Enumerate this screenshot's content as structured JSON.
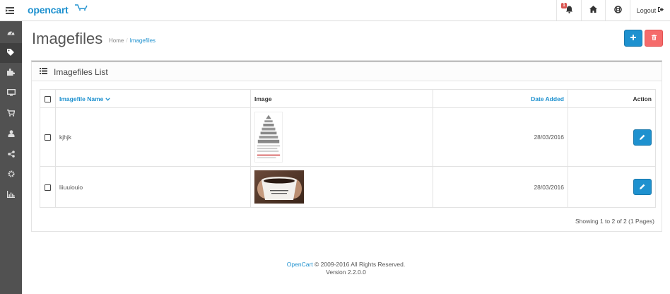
{
  "header": {
    "logo_text": "opencart",
    "notification_count": "1",
    "logout_label": "Logout"
  },
  "sidebar": {
    "items": [
      {
        "icon": "dashboard-icon"
      },
      {
        "icon": "tags-icon",
        "active": true
      },
      {
        "icon": "puzzle-icon"
      },
      {
        "icon": "desktop-icon"
      },
      {
        "icon": "shopping-cart-icon"
      },
      {
        "icon": "user-icon"
      },
      {
        "icon": "share-icon"
      },
      {
        "icon": "cog-icon"
      },
      {
        "icon": "bar-chart-icon"
      }
    ]
  },
  "page": {
    "title": "Imagefiles",
    "breadcrumb": [
      "Home",
      "Imagefiles"
    ],
    "add_button_icon": "plus-icon",
    "delete_button_icon": "trash-icon"
  },
  "panel": {
    "title": "Imagefiles List",
    "columns": {
      "name": "Imagefile Name",
      "image": "Image",
      "date_added": "Date Added",
      "action": "Action"
    },
    "rows": [
      {
        "name": "kjhjk",
        "image": "pyramid-diagram-thumbnail",
        "date_added": "28/03/2016"
      },
      {
        "name": "liiuuiouio",
        "image": "coffee-cup-thumbnail",
        "date_added": "28/03/2016"
      }
    ],
    "pagination_text": "Showing 1 to 2 of 2 (1 Pages)"
  },
  "footer": {
    "brand": "OpenCart",
    "copyright": "© 2009-2016 All Rights Reserved.",
    "version": "Version 2.2.0.0"
  },
  "colors": {
    "primary": "#1e91cf",
    "danger": "#f56b6b",
    "sidebar": "#515151"
  }
}
